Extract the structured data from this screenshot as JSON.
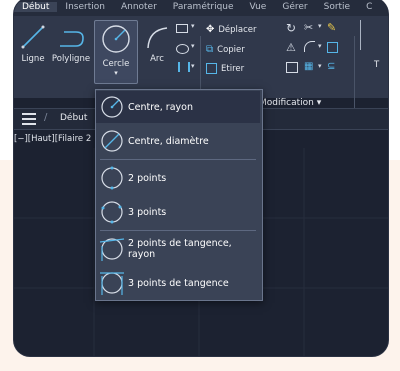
{
  "menu": {
    "tabs": [
      "Début",
      "Insertion",
      "Annoter",
      "Paramétrique",
      "Vue",
      "Gérer",
      "Sortie",
      "C"
    ]
  },
  "ribbon": {
    "tools": {
      "ligne": "Ligne",
      "polyligne": "Polyligne",
      "cercle": "Cercle",
      "arc": "Arc"
    },
    "modify": {
      "deplacer": "Déplacer",
      "copier": "Copier",
      "etirer": "Etirer"
    },
    "panel_label": "Modification ▾",
    "cut_label": "T"
  },
  "file_tab": {
    "label": "Début"
  },
  "viewport": {
    "label": "[−][Haut][Filaire 2"
  },
  "cercle_menu": {
    "items": [
      {
        "label": "Centre, rayon",
        "icon": "circle-center-radius-icon"
      },
      {
        "label": "Centre, diamètre",
        "icon": "circle-center-diameter-icon"
      },
      {
        "label": "2 points",
        "icon": "circle-2-points-icon"
      },
      {
        "label": "3 points",
        "icon": "circle-3-points-icon"
      },
      {
        "label": "2 points de tangence, rayon",
        "icon": "circle-tan-tan-radius-icon"
      },
      {
        "label": "3 points de tangence",
        "icon": "circle-tan-tan-tan-icon"
      }
    ]
  },
  "colors": {
    "accent_cyan": "#56b6e8",
    "background": "#1c2231",
    "ribbon": "#30384b"
  }
}
